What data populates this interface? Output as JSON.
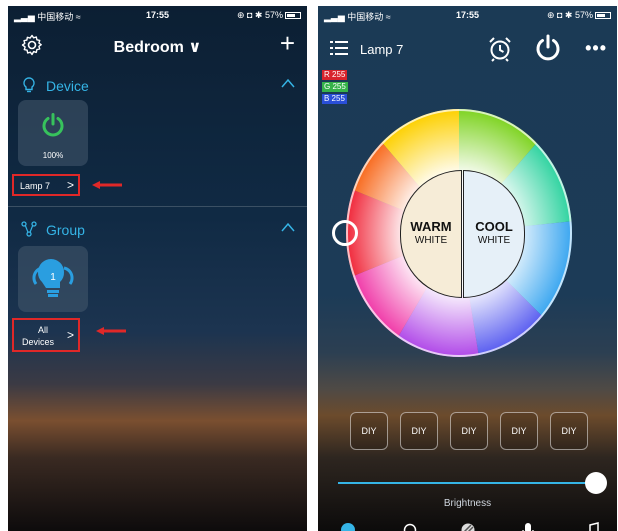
{
  "status_bar": {
    "carrier": "中国移动",
    "time": "17:55",
    "battery": "57%"
  },
  "left_screen": {
    "header": {
      "title": "Bedroom ∨"
    },
    "device_section": {
      "label": "Device",
      "tile_percent": "100%",
      "device_name": "Lamp 7",
      "device_chevron": ">"
    },
    "group_section": {
      "label": "Group",
      "group_badge": "1",
      "group_name_line1": "All",
      "group_name_line2": "Devices",
      "group_chevron": ">"
    }
  },
  "right_screen": {
    "header": {
      "title": "Lamp 7",
      "more": "•••"
    },
    "rgb": {
      "r_label": "R 255",
      "g_label": "G 255",
      "b_label": "B 255"
    },
    "white_buttons": {
      "warm_label": "WARM",
      "warm_sub": "WHITE",
      "cool_label": "COOL",
      "cool_sub": "WHITE"
    },
    "diy_buttons": [
      "DIY",
      "DIY",
      "DIY",
      "DIY",
      "DIY"
    ],
    "brightness": {
      "label": "Brightness",
      "level": 1.0
    }
  },
  "colors": {
    "accent": "#35b4e6",
    "power_green": "#37c25c",
    "highlight_red": "#e02828"
  }
}
